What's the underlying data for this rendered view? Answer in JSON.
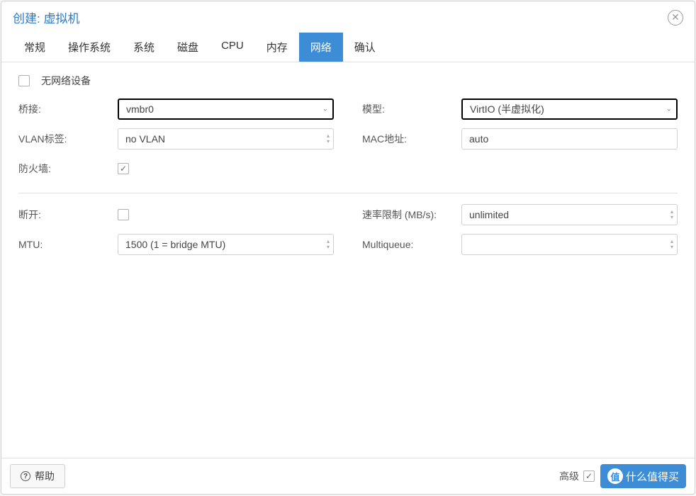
{
  "title": "创建: 虚拟机",
  "tabs": [
    "常规",
    "操作系统",
    "系统",
    "磁盘",
    "CPU",
    "内存",
    "网络",
    "确认"
  ],
  "activeTab": 6,
  "noNetwork": {
    "label": "无网络设备",
    "checked": false
  },
  "left": {
    "bridge": {
      "label": "桥接:",
      "value": "vmbr0"
    },
    "vlan": {
      "label": "VLAN标签:",
      "value": "no VLAN"
    },
    "firewall": {
      "label": "防火墙:",
      "checked": true
    },
    "disconnect": {
      "label": "断开:",
      "checked": false
    },
    "mtu": {
      "label": "MTU:",
      "value": "1500 (1 = bridge MTU)"
    }
  },
  "right": {
    "model": {
      "label": "模型:",
      "value": "VirtIO (半虚拟化)"
    },
    "mac": {
      "label": "MAC地址:",
      "value": "auto"
    },
    "rate": {
      "label": "速率限制 (MB/s):",
      "value": "unlimited"
    },
    "multiqueue": {
      "label": "Multiqueue:",
      "value": ""
    }
  },
  "footer": {
    "help": "帮助",
    "advanced": "高级",
    "watermark": "什么值得买",
    "watermarkBadge": "值"
  }
}
